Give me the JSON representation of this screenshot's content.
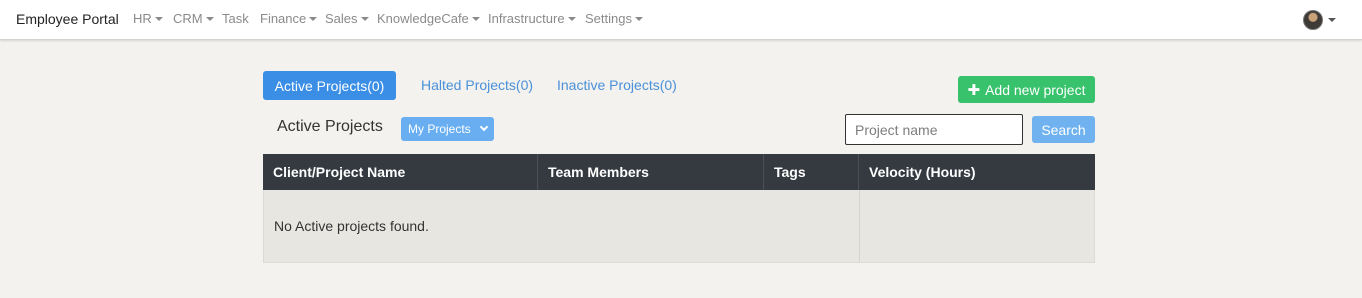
{
  "navbar": {
    "brand": "Employee Portal",
    "items": [
      {
        "label": "HR",
        "dropdown": true
      },
      {
        "label": "CRM",
        "dropdown": true
      },
      {
        "label": "Task",
        "dropdown": false
      },
      {
        "label": "Finance",
        "dropdown": true
      },
      {
        "label": "Sales",
        "dropdown": true
      },
      {
        "label": "KnowledgeCafe",
        "dropdown": true
      },
      {
        "label": "Infrastructure",
        "dropdown": true
      },
      {
        "label": "Settings",
        "dropdown": true
      }
    ],
    "user_icon": "user-avatar-icon"
  },
  "tabs": {
    "active": "Active Projects(0)",
    "halted": "Halted Projects(0)",
    "inactive": "Inactive Projects(0)"
  },
  "add_button": {
    "icon": "plus-icon",
    "label": "Add new project"
  },
  "section": {
    "title": "Active Projects",
    "filter_selected": "My Projects"
  },
  "search": {
    "placeholder": "Project name",
    "value": "",
    "button_label": "Search"
  },
  "table": {
    "columns": [
      "Client/Project Name",
      "Team Members",
      "Tags",
      "Velocity (Hours)"
    ],
    "empty_message": "No Active projects found."
  },
  "colors": {
    "page_bg": "#f3f2ee",
    "primary": "#3a8ee6",
    "success": "#37c26b",
    "table_header": "#343a40",
    "link": "#4a90d9"
  }
}
